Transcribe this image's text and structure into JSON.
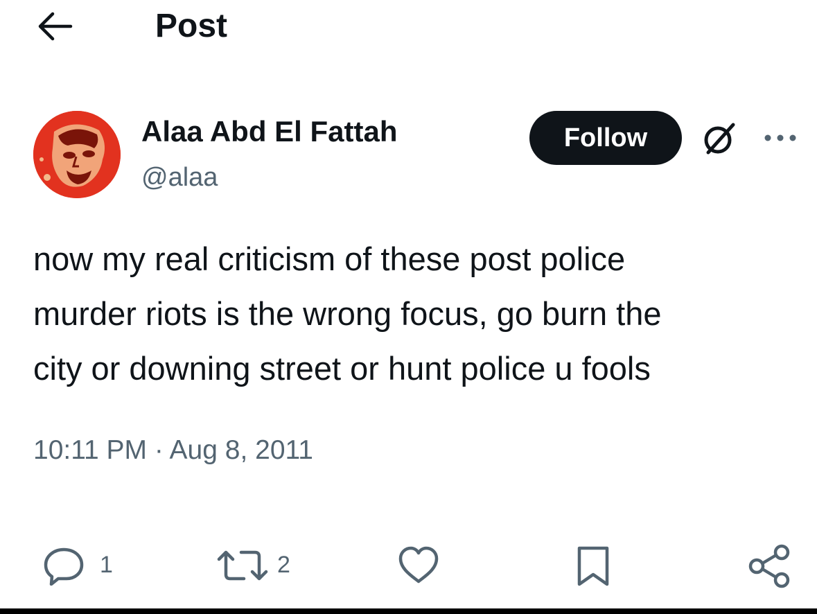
{
  "header": {
    "back_icon": "arrow-left-icon",
    "title": "Post"
  },
  "author": {
    "display_name": "Alaa Abd El Fattah",
    "handle": "@alaa",
    "avatar_color": "#e2321f"
  },
  "follow_button": {
    "label": "Follow"
  },
  "header_actions": {
    "grok_icon": "grok-icon",
    "more_icon": "more-horizontal-icon"
  },
  "post": {
    "lines": [
      "now my real criticism of these post police",
      "murder riots is the wrong focus, go burn the",
      "city or downing street or hunt police u fools"
    ],
    "timestamp": "10:11 PM · Aug 8, 2011"
  },
  "actions": {
    "reply": {
      "icon": "reply-icon",
      "count": "1"
    },
    "repost": {
      "icon": "repost-icon",
      "count": "2"
    },
    "like": {
      "icon": "heart-icon"
    },
    "bookmark": {
      "icon": "bookmark-icon"
    },
    "share": {
      "icon": "share-icon"
    }
  },
  "colors": {
    "text_primary": "#0f1419",
    "text_secondary": "#536471",
    "icon": "#536471",
    "follow_bg": "#0f1419"
  }
}
